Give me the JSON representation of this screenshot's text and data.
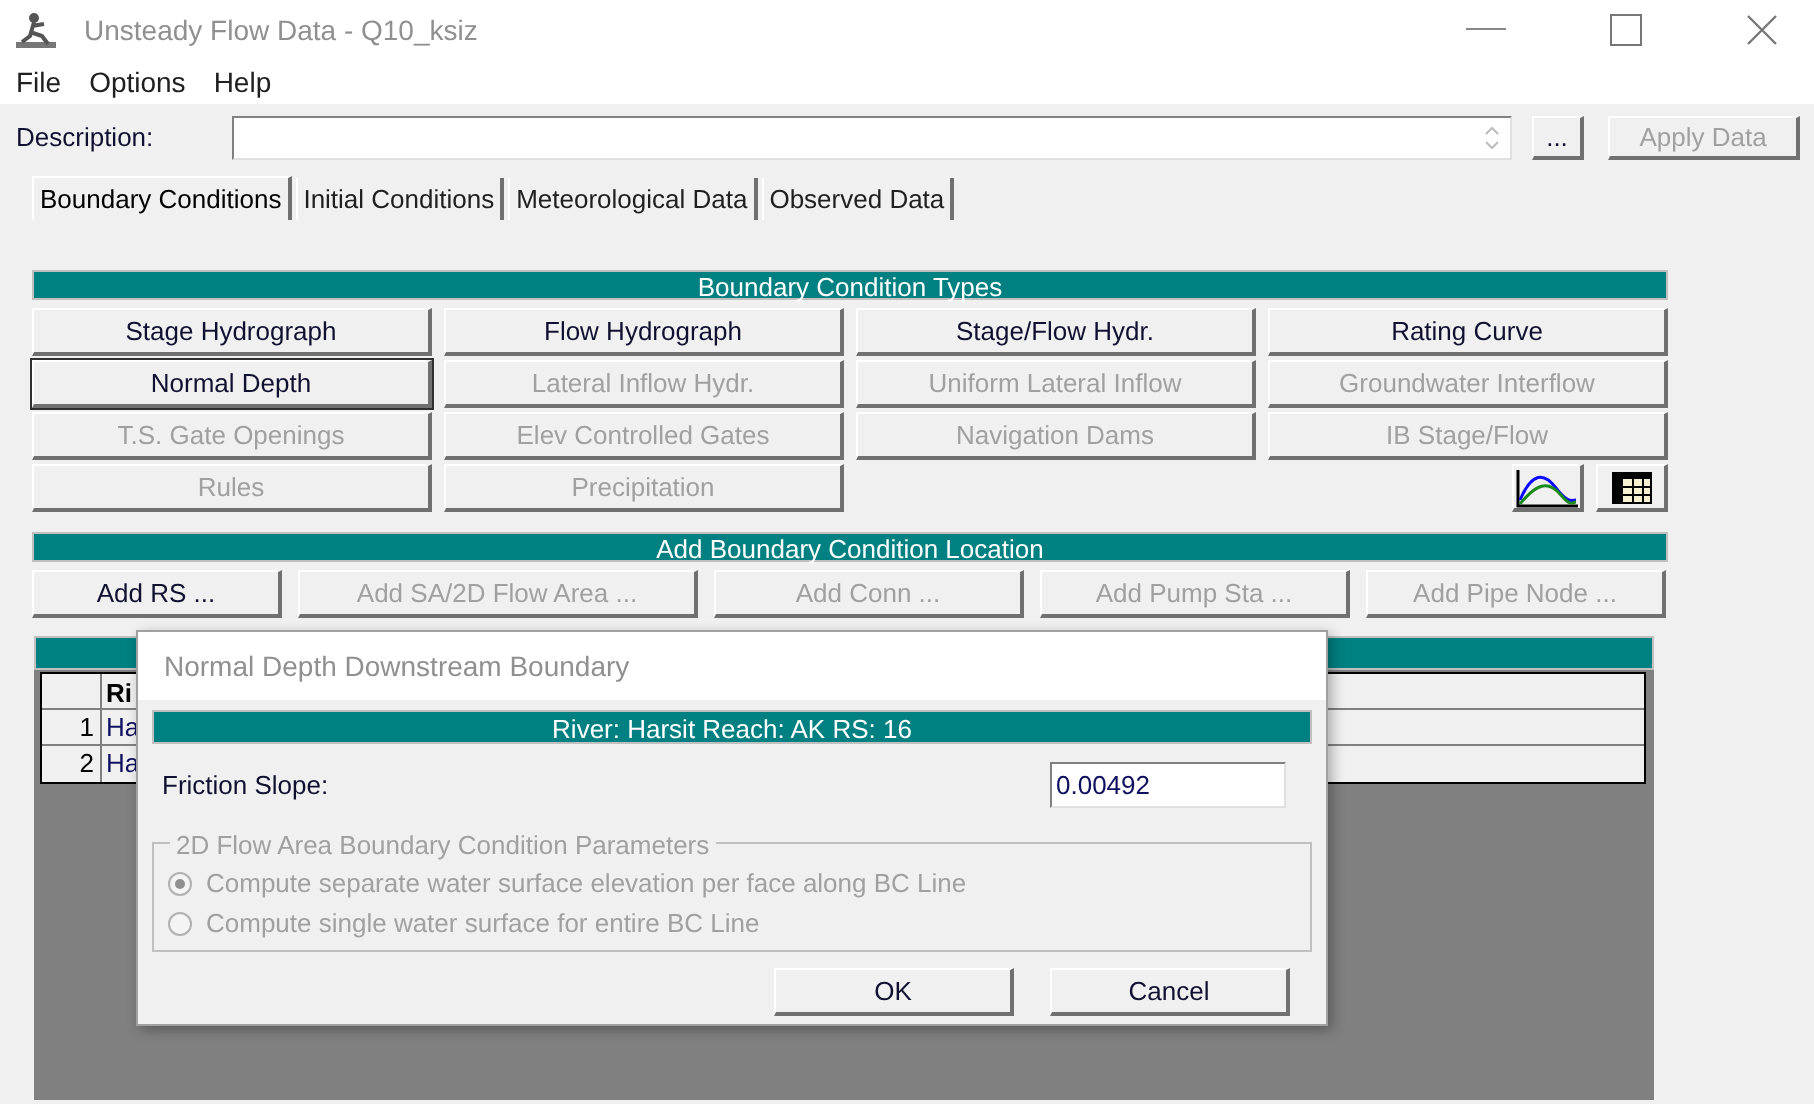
{
  "window": {
    "title": "Unsteady Flow Data - Q10_ksiz"
  },
  "menu": [
    "File",
    "Options",
    "Help"
  ],
  "description": {
    "label": "Description:",
    "browse_button": "...",
    "apply_button": {
      "label": "Apply Data",
      "disabled": true
    }
  },
  "tabs": [
    {
      "label": "Boundary Conditions",
      "selected": true
    },
    {
      "label": "Initial Conditions",
      "selected": false
    },
    {
      "label": "Meteorological Data",
      "selected": false
    },
    {
      "label": "Observed Data",
      "selected": false
    }
  ],
  "bc_types": {
    "title": "Boundary Condition Types",
    "buttons": [
      {
        "label": "Stage Hydrograph",
        "disabled": false,
        "selected": false
      },
      {
        "label": "Flow Hydrograph",
        "disabled": false,
        "selected": false
      },
      {
        "label": "Stage/Flow Hydr.",
        "disabled": false,
        "selected": false
      },
      {
        "label": "Rating Curve",
        "disabled": false,
        "selected": false
      },
      {
        "label": "Normal Depth",
        "disabled": false,
        "selected": true
      },
      {
        "label": "Lateral Inflow Hydr.",
        "disabled": true,
        "selected": false
      },
      {
        "label": "Uniform Lateral Inflow",
        "disabled": true,
        "selected": false
      },
      {
        "label": "Groundwater Interflow",
        "disabled": true,
        "selected": false
      },
      {
        "label": "T.S. Gate Openings",
        "disabled": true,
        "selected": false
      },
      {
        "label": "Elev Controlled Gates",
        "disabled": true,
        "selected": false
      },
      {
        "label": "Navigation Dams",
        "disabled": true,
        "selected": false
      },
      {
        "label": "IB Stage/Flow",
        "disabled": true,
        "selected": false
      },
      {
        "label": "Rules",
        "disabled": true,
        "selected": false
      },
      {
        "label": "Precipitation",
        "disabled": true,
        "selected": false
      }
    ]
  },
  "add_location": {
    "title": "Add Boundary Condition Location",
    "buttons": [
      {
        "label": "Add RS ...",
        "disabled": false
      },
      {
        "label": "Add SA/2D Flow Area ...",
        "disabled": true
      },
      {
        "label": "Add Conn ...",
        "disabled": true
      },
      {
        "label": "Add Pump Sta ...",
        "disabled": true
      },
      {
        "label": "Add Pipe Node ...",
        "disabled": true
      }
    ]
  },
  "table": {
    "column_2": "Ri",
    "rows": [
      {
        "number": "1",
        "column_2": "Ha"
      },
      {
        "number": "2",
        "column_2": "Ha"
      }
    ]
  },
  "dialog": {
    "title": "Normal Depth Downstream Boundary",
    "location": "River: Harsit  Reach: AK  RS: 16",
    "friction_slope": {
      "label": "Friction Slope:",
      "value": "0.00492"
    },
    "group": {
      "title": "2D Flow Area Boundary Condition Parameters",
      "disabled": true,
      "options": [
        {
          "label": "Compute separate water surface elevation per face along BC Line",
          "selected": true
        },
        {
          "label": "Compute single water surface for entire BC Line",
          "selected": false
        }
      ]
    },
    "buttons": [
      "OK",
      "Cancel"
    ]
  }
}
